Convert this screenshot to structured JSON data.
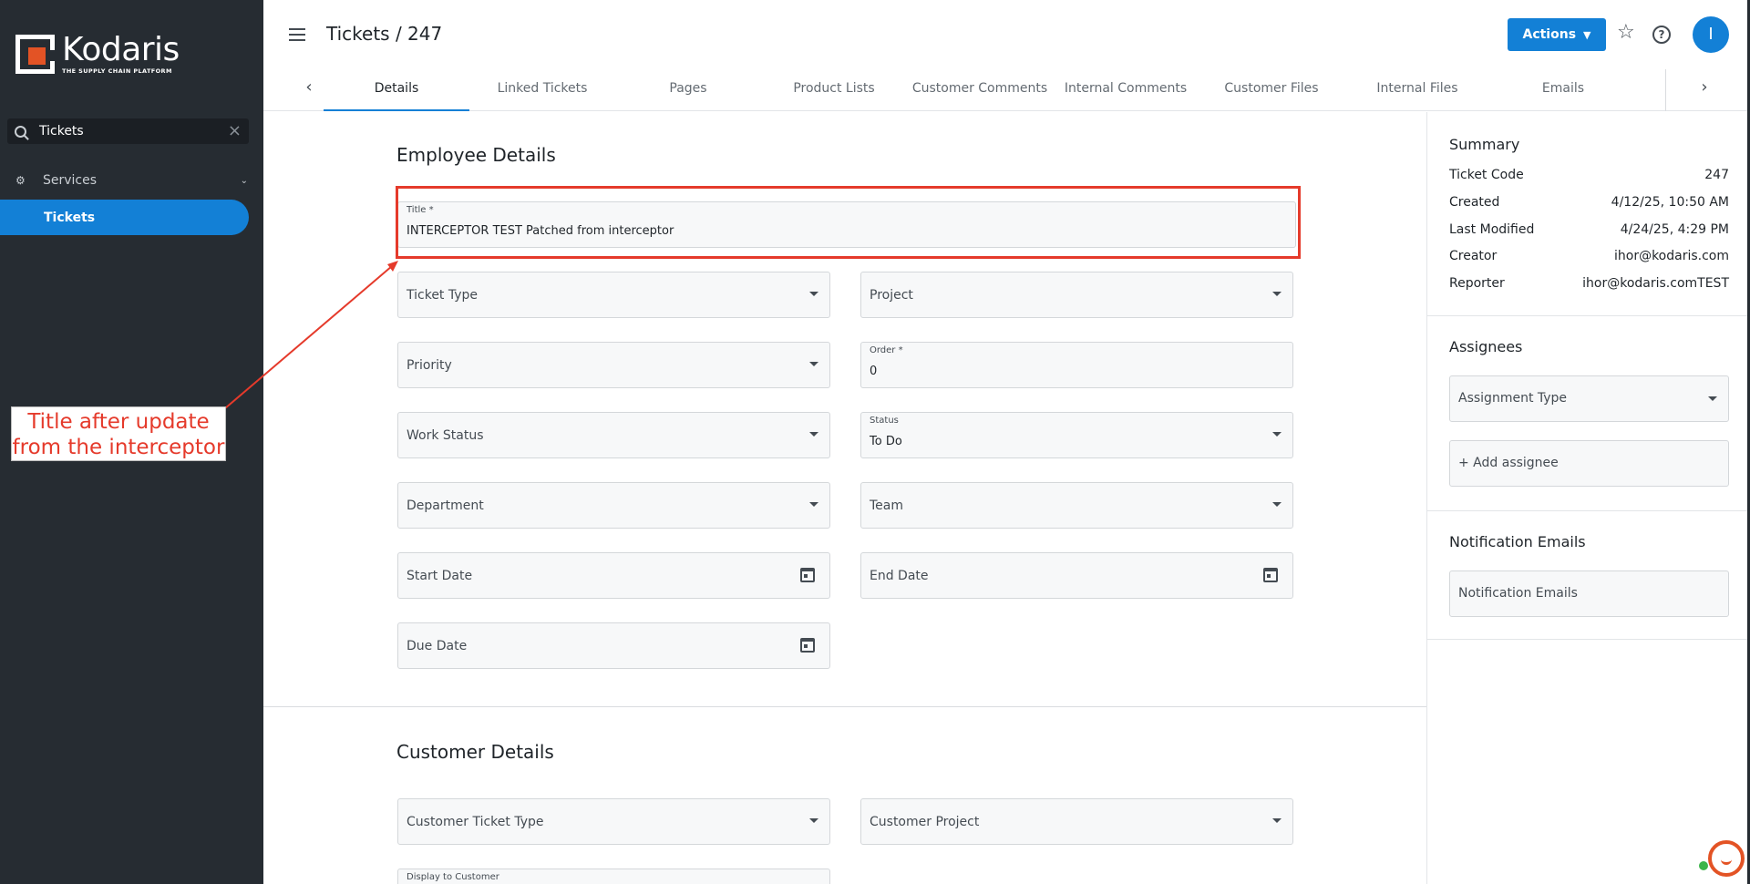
{
  "sidebar": {
    "logo": {
      "name": "Kodaris",
      "tagline": "THE SUPPLY CHAIN PLATFORM"
    },
    "search": {
      "value": "Tickets",
      "clear": "×"
    },
    "group": {
      "label": "Services",
      "icon": "gears-icon"
    },
    "active_item": {
      "label": "Tickets"
    }
  },
  "header": {
    "title": "Tickets / 247",
    "actions_label": "Actions",
    "avatar_initial": "I",
    "tabs": [
      {
        "label": "Details",
        "active": true
      },
      {
        "label": "Linked Tickets"
      },
      {
        "label": "Pages"
      },
      {
        "label": "Product Lists"
      },
      {
        "label": "Customer Comments"
      },
      {
        "label": "Internal Comments"
      },
      {
        "label": "Customer Files"
      },
      {
        "label": "Internal Files"
      },
      {
        "label": "Emails"
      }
    ]
  },
  "employee_details": {
    "heading": "Employee Details",
    "title_field": {
      "label": "Title *",
      "value": "INTERCEPTOR TEST Patched from interceptor"
    },
    "ticket_type": {
      "placeholder": "Ticket Type"
    },
    "project": {
      "placeholder": "Project"
    },
    "priority": {
      "placeholder": "Priority"
    },
    "order": {
      "label": "Order *",
      "value": "0"
    },
    "work_status": {
      "placeholder": "Work Status"
    },
    "status": {
      "label": "Status",
      "value": "To Do"
    },
    "department": {
      "placeholder": "Department"
    },
    "team": {
      "placeholder": "Team"
    },
    "start_date": {
      "placeholder": "Start Date"
    },
    "end_date": {
      "placeholder": "End Date"
    },
    "due_date": {
      "placeholder": "Due Date"
    }
  },
  "customer_details": {
    "heading": "Customer Details",
    "customer_ticket_type": {
      "placeholder": "Customer Ticket Type"
    },
    "customer_project": {
      "placeholder": "Customer Project"
    },
    "display_to_customer": {
      "label": "Display to Customer"
    }
  },
  "annotation": {
    "line1": "Title after update",
    "line2": "from the interceptor",
    "color": "#e53a2b"
  },
  "summary": {
    "heading": "Summary",
    "rows": [
      {
        "label": "Ticket Code",
        "value": "247"
      },
      {
        "label": "Created",
        "value": "4/12/25, 10:50 AM"
      },
      {
        "label": "Last Modified",
        "value": "4/24/25, 4:29 PM"
      },
      {
        "label": "Creator",
        "value": "ihor@kodaris.com"
      },
      {
        "label": "Reporter",
        "value": "ihor@kodaris.comTEST"
      }
    ]
  },
  "assignees": {
    "heading": "Assignees",
    "assignment_type": "Assignment Type",
    "add_label": "+ Add assignee"
  },
  "notifications": {
    "heading": "Notification Emails",
    "field": "Notification Emails"
  },
  "colors": {
    "brand_blue": "#1380d6",
    "sidebar_bg": "#262c32",
    "brand_orange": "#e35325"
  }
}
